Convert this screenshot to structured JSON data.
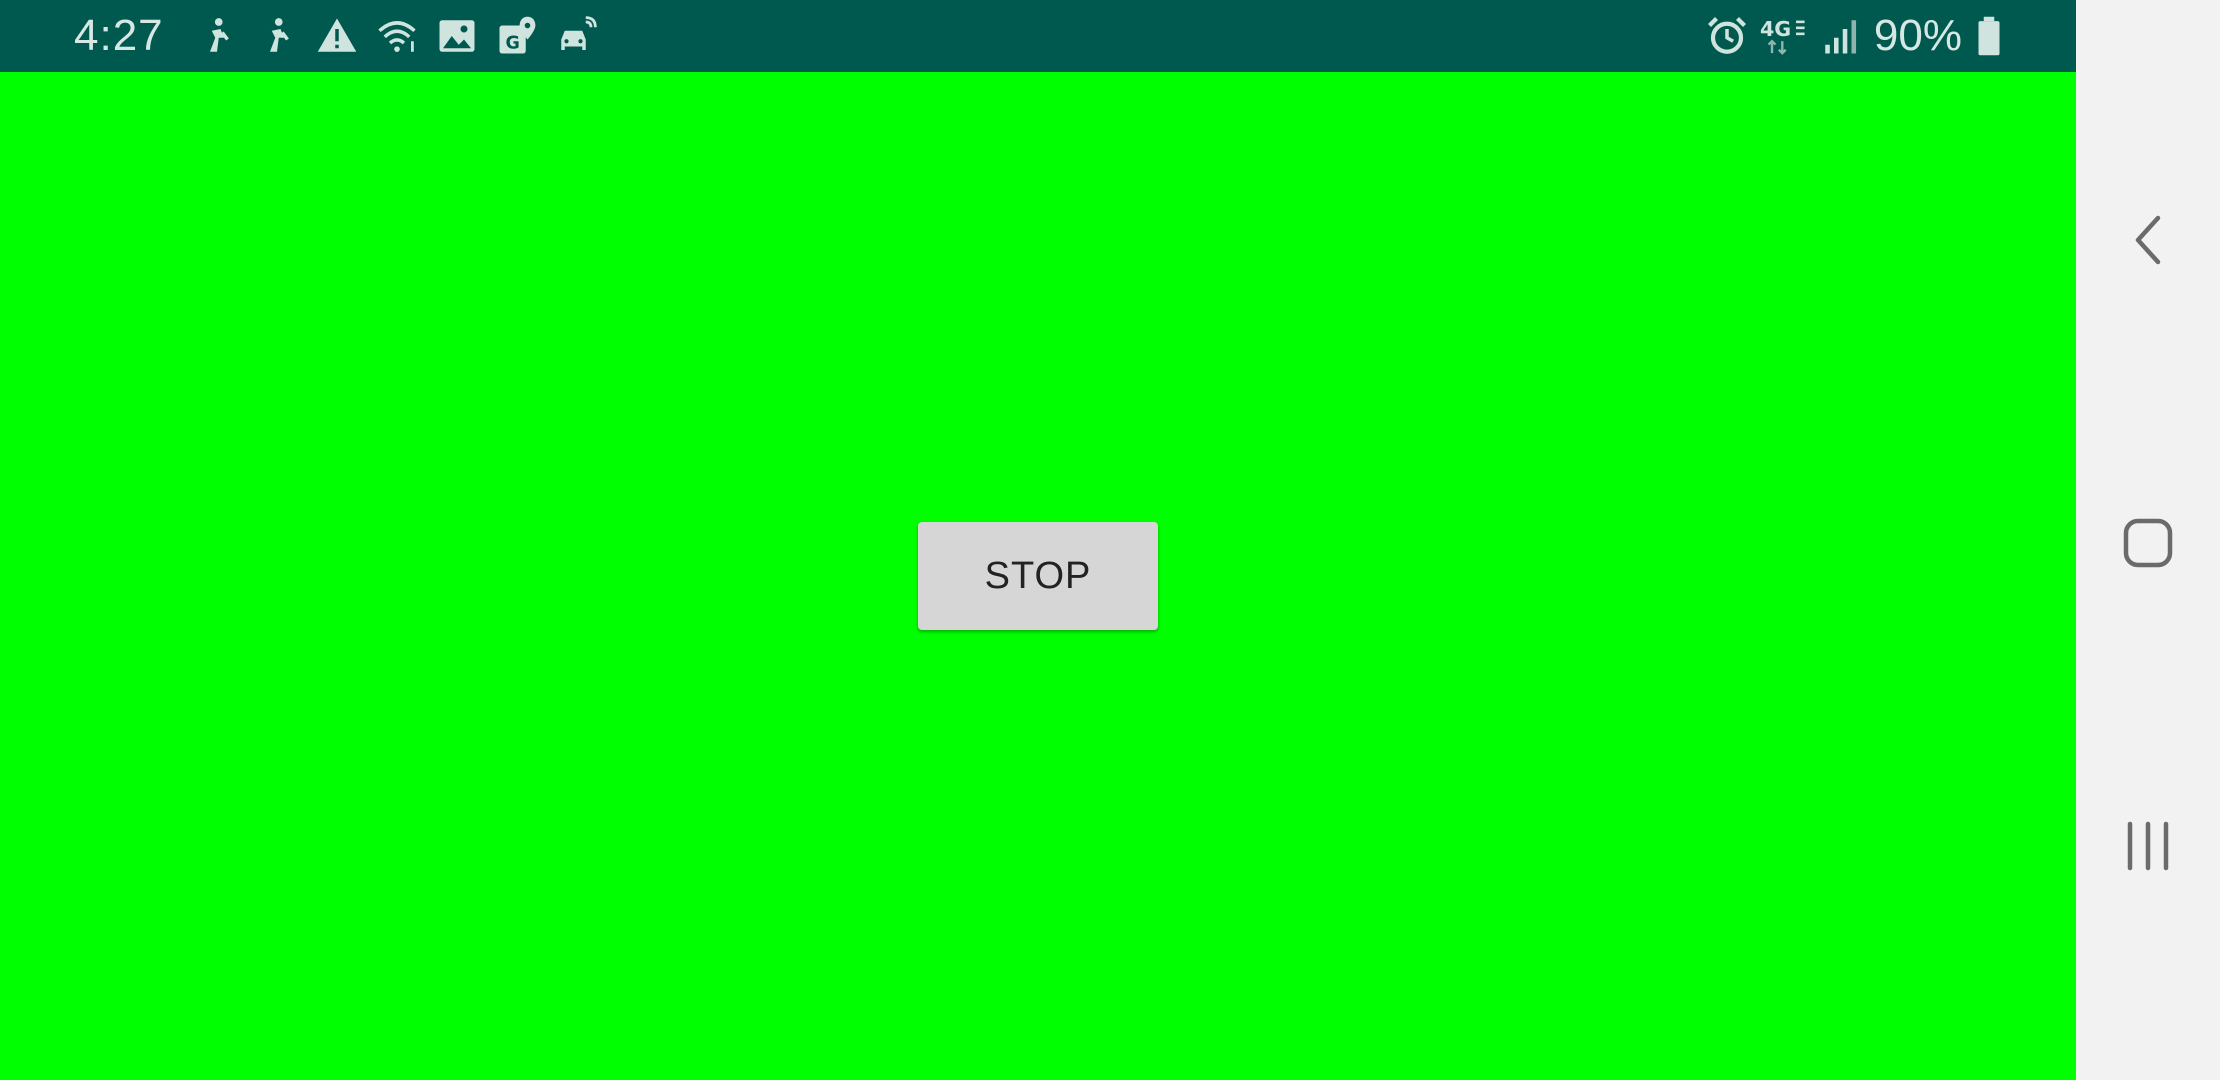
{
  "status_bar": {
    "time": "4:27",
    "battery_percent": "90%",
    "left_icons": [
      "person-icon",
      "person-icon",
      "warning-icon",
      "wifi-icon",
      "image-icon",
      "map-pin-icon",
      "car-icon"
    ],
    "right_icons": [
      "alarm-icon",
      "lte-4g-icon",
      "signal-icon",
      "battery-icon"
    ],
    "background_color": "#00594f"
  },
  "app": {
    "background_color": "#00ff00",
    "stop_button_label": "STOP"
  },
  "nav_bar": {
    "buttons": [
      "back-icon",
      "home-icon",
      "recents-icon"
    ],
    "background_color": "#f2f2f2"
  }
}
